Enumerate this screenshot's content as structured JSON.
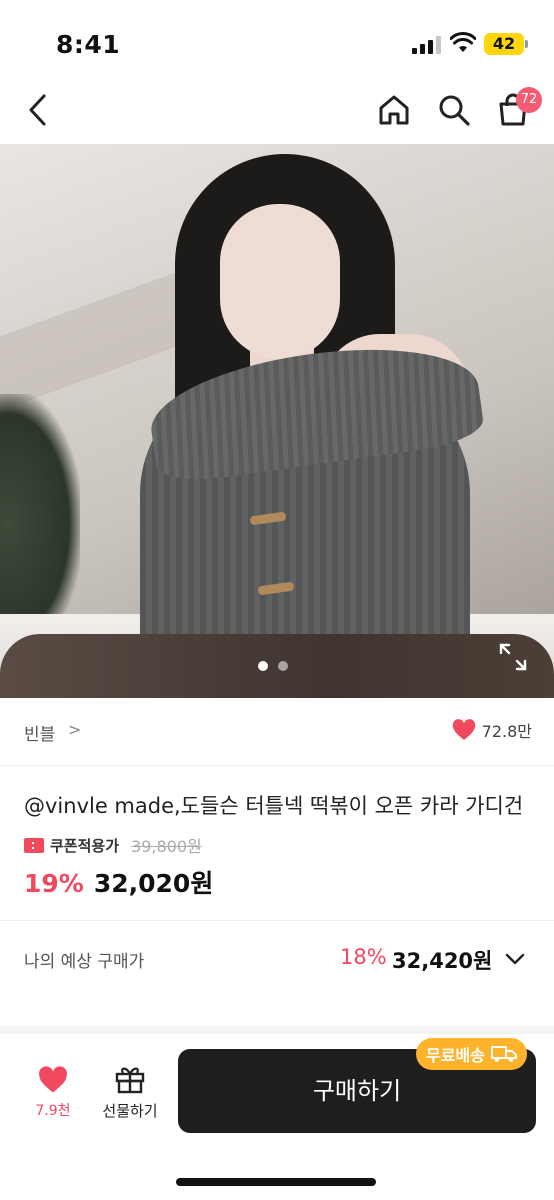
{
  "status": {
    "time": "8:41",
    "battery": "42"
  },
  "header": {
    "cart_count": "72"
  },
  "gallery": {
    "total": 2,
    "active": 0
  },
  "brand": {
    "name": "빈블",
    "chevron": ">",
    "likes": "72.8만"
  },
  "product": {
    "title": "@vinvle made,도들슨 터틀넥 떡볶이 오픈 카라 가디건",
    "coupon_label": "쿠폰적용가",
    "original_price": "39,800원",
    "discount": "19%",
    "price": "32,020원"
  },
  "estimate": {
    "label": "나의 예상 구매가",
    "discount": "18%",
    "price": "32,420원"
  },
  "bottom": {
    "wish_count": "7.9천",
    "gift_label": "선물하기",
    "buy_label": "구매하기",
    "shipping_badge": "무료배송"
  },
  "colors": {
    "accent": "#f0485e",
    "badge": "#ffb32c",
    "button": "#1e1e1e"
  },
  "icons": [
    "back-icon",
    "home-icon",
    "search-icon",
    "cart-icon",
    "expand-icon",
    "heart-icon",
    "gift-icon",
    "truck-icon",
    "chevron-down-icon"
  ]
}
